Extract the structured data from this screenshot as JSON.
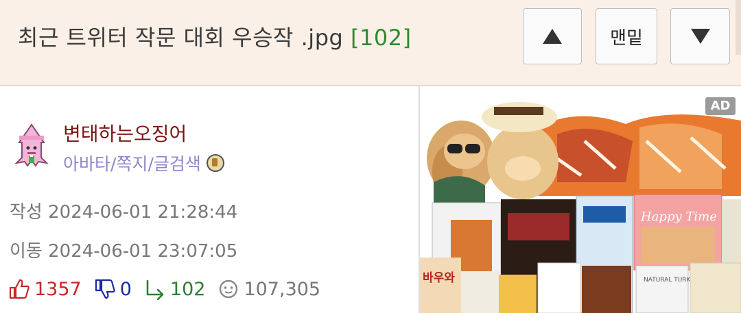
{
  "header": {
    "title": "최근 트위터 작문 대회 우승작 .jpg",
    "comment_count": "[102]",
    "up_label": "up",
    "bottom_label": "맨밑",
    "down_label": "down"
  },
  "author": {
    "nickname": "변태하는오징어",
    "links": [
      "아바타",
      "쪽지",
      "글검색"
    ],
    "separator": "/"
  },
  "meta": {
    "created_label": "작성",
    "created": "2024-06-01 21:28:44",
    "moved_label": "이동",
    "moved": "2024-06-01 23:07:05"
  },
  "stats": {
    "upvotes": "1357",
    "downvotes": "0",
    "replies": "102",
    "views": "107,305"
  },
  "ad": {
    "badge": "AD",
    "package_text": [
      "Happy Time",
      "바우와",
      "NATURAL TURKEY"
    ]
  },
  "colors": {
    "header_bg": "#fbf0e7",
    "title": "#3a3a3a",
    "count": "#2f8a2f",
    "nickname": "#7a1414",
    "links": "#8d87c7",
    "upvote": "#c62828",
    "downvote": "#1d2aa0",
    "reply": "#2e7d32"
  }
}
